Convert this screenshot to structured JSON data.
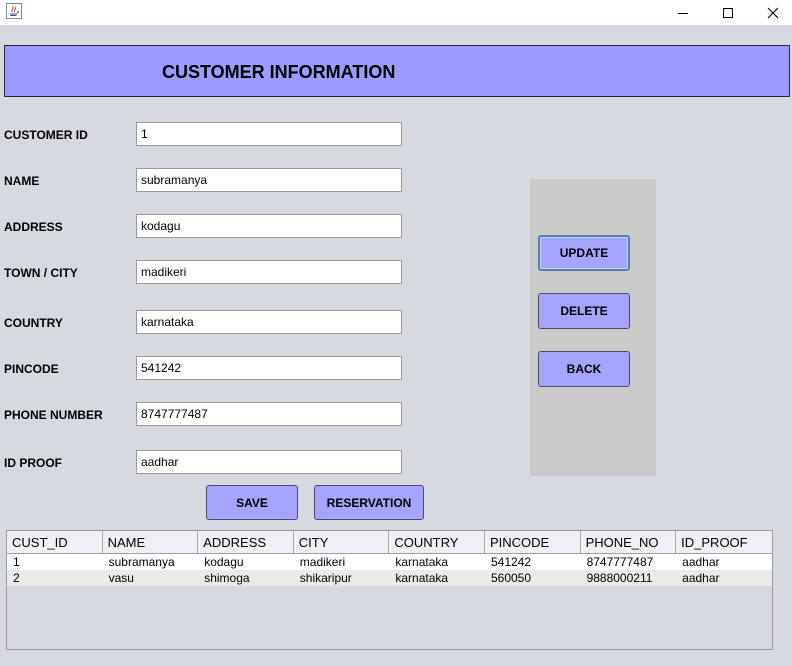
{
  "window": {
    "icons": {
      "app": "java-icon",
      "minimize": "minimize-icon",
      "maximize": "maximize-icon",
      "close": "close-icon"
    }
  },
  "header": {
    "title": "CUSTOMER INFORMATION"
  },
  "form": {
    "fields": [
      {
        "label": "CUSTOMER ID",
        "value": "1"
      },
      {
        "label": "NAME",
        "value": "subramanya"
      },
      {
        "label": "ADDRESS",
        "value": "kodagu"
      },
      {
        "label": "TOWN / CITY",
        "value": "madikeri"
      },
      {
        "label": "COUNTRY",
        "value": "karnataka"
      },
      {
        "label": "PINCODE",
        "value": "541242"
      },
      {
        "label": "PHONE NUMBER",
        "value": "8747777487"
      },
      {
        "label": "ID PROOF",
        "value": "aadhar"
      }
    ],
    "save_label": "SAVE",
    "reservation_label": "RESERVATION"
  },
  "side_panel": {
    "update_label": "UPDATE",
    "delete_label": "DELETE",
    "back_label": "BACK"
  },
  "table": {
    "columns": [
      "CUST_ID",
      "NAME",
      "ADDRESS",
      "CITY",
      "COUNTRY",
      "PINCODE",
      "PHONE_NO",
      "ID_PROOF"
    ],
    "rows": [
      [
        "1",
        "subramanya",
        "kodagu",
        "madikeri",
        "karnataka",
        "541242",
        "8747777487",
        "aadhar"
      ],
      [
        "2",
        "vasu",
        "shimoga",
        "shikaripur",
        "karnataka",
        "560050",
        "9888000211",
        "aadhar"
      ]
    ]
  },
  "colors": {
    "header_bg": "#9c9cff",
    "button_bg": "#a5a5ff",
    "panel_bg": "#cacaca",
    "window_bg": "#d6d9df"
  }
}
